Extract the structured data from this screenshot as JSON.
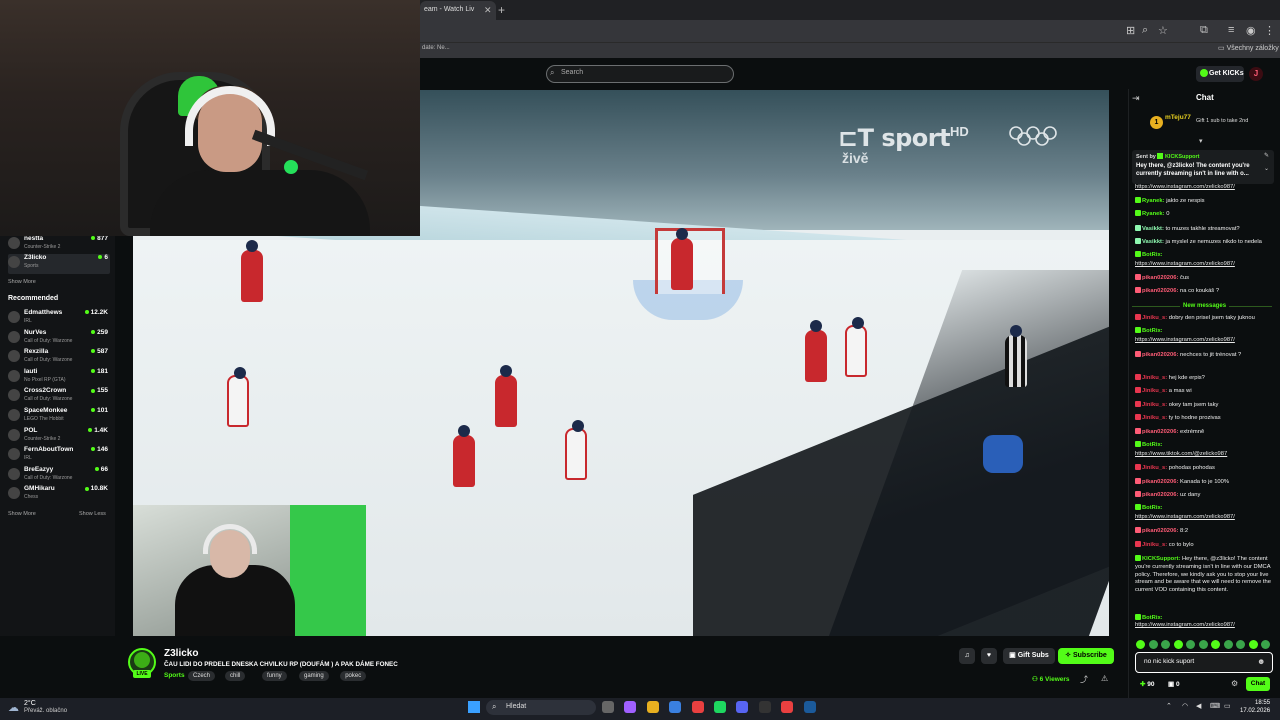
{
  "browser": {
    "tab_title": "eam - Watch Liv",
    "bookmark_text": "date: Ne...",
    "all_bookmarks": "Všechny záložky"
  },
  "header": {
    "search_placeholder": "Search",
    "get_kicks_label": "Get KICKs",
    "user_initial": "J"
  },
  "sidebar": {
    "following": [
      {
        "name": "nestta",
        "category": "Counter-Strike 2",
        "viewers": "877"
      },
      {
        "name": "Z3licko",
        "category": "Sports",
        "viewers": "6"
      }
    ],
    "show_more_1": "Show More",
    "recommended_title": "Recommended",
    "recommended": [
      {
        "name": "Edmatthews",
        "category": "IRL",
        "viewers": "12.2K"
      },
      {
        "name": "NurVes",
        "category": "Call of Duty: Warzone",
        "viewers": "259"
      },
      {
        "name": "Rexzilla",
        "category": "Call of Duty: Warzone",
        "viewers": "587"
      },
      {
        "name": "lauti",
        "category": "No Pixel RP (GTA)",
        "viewers": "181"
      },
      {
        "name": "Cross2Crown",
        "category": "Call of Duty: Warzone",
        "viewers": "155"
      },
      {
        "name": "SpaceMonkee",
        "category": "LEGO The Hobbit",
        "viewers": "101"
      },
      {
        "name": "POL",
        "category": "Counter-Strike 2",
        "viewers": "1.4K"
      },
      {
        "name": "FernAboutTown",
        "category": "IRL",
        "viewers": "146"
      },
      {
        "name": "BreEazyy",
        "category": "Call of Duty: Warzone",
        "viewers": "66"
      },
      {
        "name": "GMHikaru",
        "category": "Chess",
        "viewers": "10.8K"
      }
    ],
    "show_more_2": "Show More",
    "show_less": "Show Less"
  },
  "video": {
    "broadcaster_logo": "sport",
    "broadcaster_hd": "HD",
    "live_word": "živě"
  },
  "stream": {
    "channel_name": "Z3licko",
    "title": "ČAU LIDI DO PRDELE DNESKA CHVILKU RP (DOUFÁM ) A PAK DÁME FONEC",
    "category": "Sports",
    "tags": [
      "Czech",
      "chill",
      "funny",
      "gaming",
      "pokec"
    ],
    "live_badge": "LIVE",
    "gift_subs_label": "Gift Subs",
    "subscribe_label": "Subscribe",
    "viewers": "6 Viewers"
  },
  "chat": {
    "title": "Chat",
    "gift_user": "mTeju77",
    "gift_count": "1",
    "gift_text": "Gift 1 sub to take 2nd",
    "pinned_sender_prefix": "Sent by",
    "pinned_sender": "KICKSupport",
    "pinned_text": "Hey there, @z3licko! The content you're currently streaming isn't in line with o...",
    "new_messages_label": "New messages",
    "messages": [
      {
        "user": "",
        "text": "https://www.instagram.com/zelicko987/",
        "link": true,
        "color": "#e8e8e8"
      },
      {
        "user": "Ryanek:",
        "text": "jakto ze nespis",
        "color": "#53fc18"
      },
      {
        "user": "Ryanek:",
        "text": "0",
        "color": "#53fc18"
      },
      {
        "user": "Vasikkt:",
        "text": "to muzes takhle streamovat?",
        "color": "#8ef8b0"
      },
      {
        "user": "Vasikkt:",
        "text": "ja myslel ze nemuzes nikdo to nedela",
        "color": "#8ef8b0"
      },
      {
        "user": "BotRix:",
        "text": "",
        "color": "#53fc18"
      },
      {
        "user": "",
        "text": "https://www.instagram.com/zelicko987/",
        "link": true,
        "color": "#e8e8e8"
      },
      {
        "user": "pikan020206:",
        "text": "čus",
        "color": "#ff5c76"
      },
      {
        "user": "pikan020206:",
        "text": "na co koukáš ?",
        "color": "#ff5c76"
      },
      {
        "user": "Jiniku_s:",
        "text": "dobry den prisel jsem taky juknou",
        "color": "#e8364f"
      },
      {
        "user": "BotRix:",
        "text": "",
        "color": "#53fc18"
      },
      {
        "user": "",
        "text": "https://www.instagram.com/zelicko987/",
        "link": true,
        "color": "#e8e8e8"
      },
      {
        "user": "pikan020206:",
        "text": "nechces to jit trénovat ?",
        "color": "#ff5c76"
      },
      {
        "user": "Jiniku_s:",
        "text": "hej kde erpis?",
        "color": "#e8364f"
      },
      {
        "user": "Jiniku_s:",
        "text": "a mas wi",
        "color": "#e8364f"
      },
      {
        "user": "Jiniku_s:",
        "text": "okey tam jsem taky",
        "color": "#e8364f"
      },
      {
        "user": "Jiniku_s:",
        "text": "ty to hodne prozivas",
        "color": "#e8364f"
      },
      {
        "user": "pikan020206:",
        "text": "extrémně",
        "color": "#ff5c76"
      },
      {
        "user": "BotRix:",
        "text": "",
        "color": "#53fc18"
      },
      {
        "user": "",
        "text": "https://www.tiktok.com/@zelicko987",
        "link": true,
        "color": "#e8e8e8"
      },
      {
        "user": "Jiniku_s:",
        "text": "pohodas pohodas",
        "color": "#e8364f"
      },
      {
        "user": "pikan020206:",
        "text": "Kanada to je 100%",
        "color": "#ff5c76"
      },
      {
        "user": "pikan020206:",
        "text": "uz dany",
        "color": "#ff5c76"
      },
      {
        "user": "BotRix:",
        "text": "",
        "color": "#53fc18"
      },
      {
        "user": "",
        "text": "https://www.instagram.com/zelicko987/",
        "link": true,
        "color": "#e8e8e8"
      },
      {
        "user": "pikan020206:",
        "text": "8:2",
        "color": "#ff5c76"
      },
      {
        "user": "Jiniku_s:",
        "text": "co to bylo",
        "color": "#e8364f"
      },
      {
        "user": "KICKSupport:",
        "text": "Hey there, @z3licko! The content you're currently streaming isn't in line with our DMCA policy. Therefore, we kindly ask you to stop your live stream and be aware that we will need to remove the current VOD containing this content.",
        "color": "#53fc18"
      },
      {
        "user": "BotRix:",
        "text": "",
        "color": "#53fc18"
      },
      {
        "user": "",
        "text": "https://www.instagram.com/zelicko987/",
        "link": true,
        "color": "#e8e8e8"
      }
    ],
    "input_value": "no nic kick suport",
    "points": "90",
    "points2": "0",
    "send_label": "Chat"
  },
  "taskbar": {
    "temp": "2°C",
    "weather": "Převáž. oblačno",
    "search_label": "Hledat",
    "time": "18:55",
    "date": "17.02.2026"
  },
  "colors": {
    "accent": "#53fc18",
    "bg": "#0b0e0f"
  }
}
